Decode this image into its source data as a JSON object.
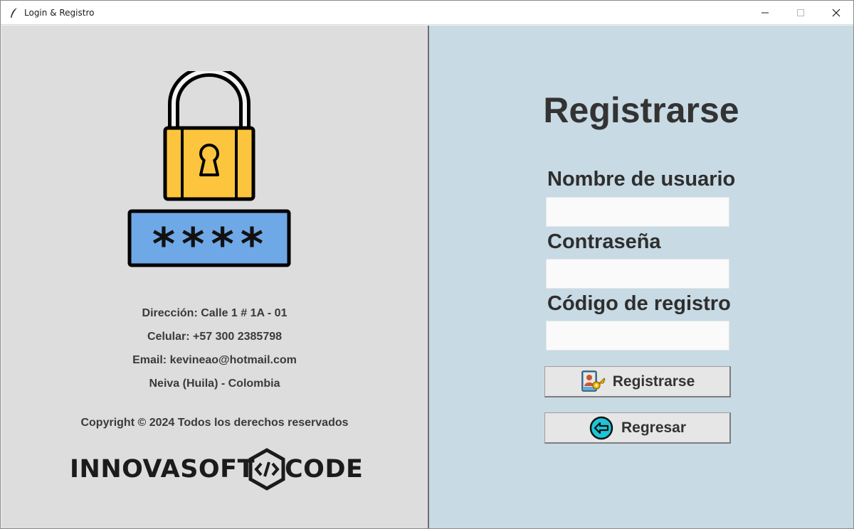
{
  "window": {
    "title": "Login & Registro",
    "controls": [
      "minimize-icon",
      "maximize-icon",
      "close-icon"
    ]
  },
  "left_panel": {
    "illustration": "padlock-password-icon",
    "password_mask": "****",
    "contact": {
      "address": "Dirección: Calle 1 # 1A - 01",
      "phone": "Celular: +57 300 2385798",
      "email": "Email: kevineao@hotmail.com",
      "city": "Neiva (Huila) - Colombia"
    },
    "copyright": "Copyright © 2024 Todos los derechos reservados",
    "brand": {
      "left": "INNOVASOFT",
      "right": "CODE"
    }
  },
  "form": {
    "title": "Registrarse",
    "fields": [
      {
        "label": "Nombre de usuario",
        "value": "",
        "placeholder": ""
      },
      {
        "label": "Contraseña",
        "value": "",
        "placeholder": ""
      },
      {
        "label": "Código de registro",
        "value": "",
        "placeholder": ""
      }
    ],
    "buttons": {
      "register": {
        "label": "Registrarse",
        "icon": "user-key-icon"
      },
      "back": {
        "label": "Regresar",
        "icon": "arrow-left-circle-icon"
      }
    }
  },
  "colors": {
    "left_bg": "#dddddd",
    "right_bg": "#c8dae4",
    "lock_body": "#fcc53d",
    "password_box": "#6fa8e6",
    "back_icon": "#1ec4d8"
  }
}
